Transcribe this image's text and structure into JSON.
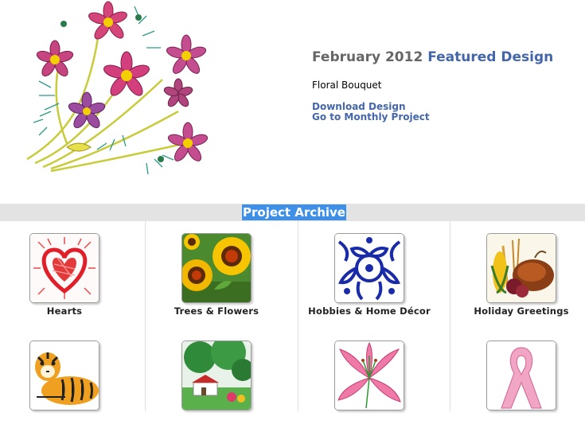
{
  "featured": {
    "month": "February 2012",
    "heading": "Featured Design",
    "design_name": "Floral Bouquet",
    "download_label": "Download Design",
    "project_label": "Go to Monthly Project"
  },
  "archive": {
    "label": "Project Archive",
    "categories": [
      {
        "label": "Hearts",
        "icon": "heart-thumbnail"
      },
      {
        "label": "Trees & Flowers",
        "icon": "sunflowers-thumbnail"
      },
      {
        "label": "Hobbies & Home Décor",
        "icon": "blue-lace-thumbnail"
      },
      {
        "label": "Holiday Greetings",
        "icon": "harvest-thumbnail"
      },
      {
        "label": "",
        "icon": "tiger-thumbnail"
      },
      {
        "label": "",
        "icon": "landscape-thumbnail"
      },
      {
        "label": "",
        "icon": "lily-thumbnail"
      },
      {
        "label": "",
        "icon": "pink-ribbon-thumbnail"
      }
    ]
  },
  "colors": {
    "link_blue": "#4466aa",
    "title_gray": "#666666",
    "archive_highlight": "#3d8fe8",
    "bar_gray": "#e3e3e3"
  }
}
